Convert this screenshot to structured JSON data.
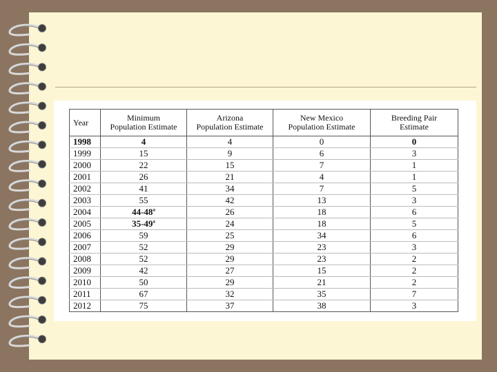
{
  "table": {
    "headers": {
      "year": "Year",
      "min_line1": "Minimum",
      "min_line2": "Population Estimate",
      "az_line1": "Arizona",
      "az_line2": "Population Estimate",
      "nm_line1": "New Mexico",
      "nm_line2": "Population Estimate",
      "bp_line1": "Breeding Pair",
      "bp_line2": "Estimate"
    },
    "footnote_mark": "a",
    "rows": [
      {
        "year": "1998",
        "min": "4",
        "az": "4",
        "nm": "0",
        "bp": "0"
      },
      {
        "year": "1999",
        "min": "15",
        "az": "9",
        "nm": "6",
        "bp": "3"
      },
      {
        "year": "2000",
        "min": "22",
        "az": "15",
        "nm": "7",
        "bp": "1"
      },
      {
        "year": "2001",
        "min": "26",
        "az": "21",
        "nm": "4",
        "bp": "1"
      },
      {
        "year": "2002",
        "min": "41",
        "az": "34",
        "nm": "7",
        "bp": "5"
      },
      {
        "year": "2003",
        "min": "55",
        "az": "42",
        "nm": "13",
        "bp": "3"
      },
      {
        "year": "2004",
        "min": "44-48",
        "az": "26",
        "nm": "18",
        "bp": "6"
      },
      {
        "year": "2005",
        "min": "35-49",
        "az": "24",
        "nm": "18",
        "bp": "5"
      },
      {
        "year": "2006",
        "min": "59",
        "az": "25",
        "nm": "34",
        "bp": "6"
      },
      {
        "year": "2007",
        "min": "52",
        "az": "29",
        "nm": "23",
        "bp": "3"
      },
      {
        "year": "2008",
        "min": "52",
        "az": "29",
        "nm": "23",
        "bp": "2"
      },
      {
        "year": "2009",
        "min": "42",
        "az": "27",
        "nm": "15",
        "bp": "2"
      },
      {
        "year": "2010",
        "min": "50",
        "az": "29",
        "nm": "21",
        "bp": "2"
      },
      {
        "year": "2011",
        "min": "67",
        "az": "32",
        "nm": "35",
        "bp": "7"
      },
      {
        "year": "2012",
        "min": "75",
        "az": "37",
        "nm": "38",
        "bp": "3"
      }
    ]
  }
}
